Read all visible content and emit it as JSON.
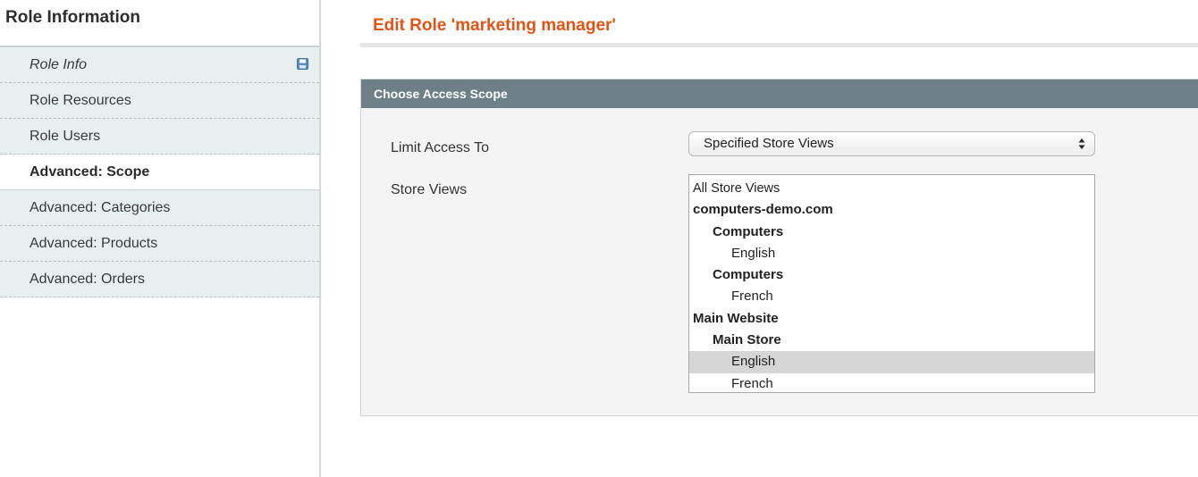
{
  "sidebar": {
    "title": "Role Information",
    "tabs": [
      {
        "label": "Role Info",
        "italic": true,
        "has_icon": "save-icon"
      },
      {
        "label": "Role Resources"
      },
      {
        "label": "Role Users"
      },
      {
        "label": "Advanced: Scope",
        "active": true
      },
      {
        "label": "Advanced: Categories"
      },
      {
        "label": "Advanced: Products"
      },
      {
        "label": "Advanced: Orders"
      }
    ]
  },
  "main": {
    "page_title": "Edit Role 'marketing manager'",
    "fieldset": {
      "header": "Choose Access Scope",
      "limit_access": {
        "label": "Limit Access To",
        "selected_value": "Specified Store Views"
      },
      "store_views": {
        "label": "Store Views",
        "options": [
          {
            "label": "All Store Views",
            "kind": "plain"
          },
          {
            "label": "computers-demo.com",
            "kind": "website"
          },
          {
            "label": "Computers",
            "kind": "store"
          },
          {
            "label": "English",
            "kind": "view"
          },
          {
            "label": "Computers",
            "kind": "store"
          },
          {
            "label": "French",
            "kind": "view"
          },
          {
            "label": "Main Website",
            "kind": "website"
          },
          {
            "label": "Main Store",
            "kind": "store"
          },
          {
            "label": "English",
            "kind": "view",
            "selected": true
          },
          {
            "label": "French",
            "kind": "view"
          }
        ]
      }
    }
  },
  "colors": {
    "title_accent": "#e25416",
    "fieldset_header": "#6e8087",
    "tab_background": "#e7efef",
    "selected_option": "#d6d6d6"
  }
}
